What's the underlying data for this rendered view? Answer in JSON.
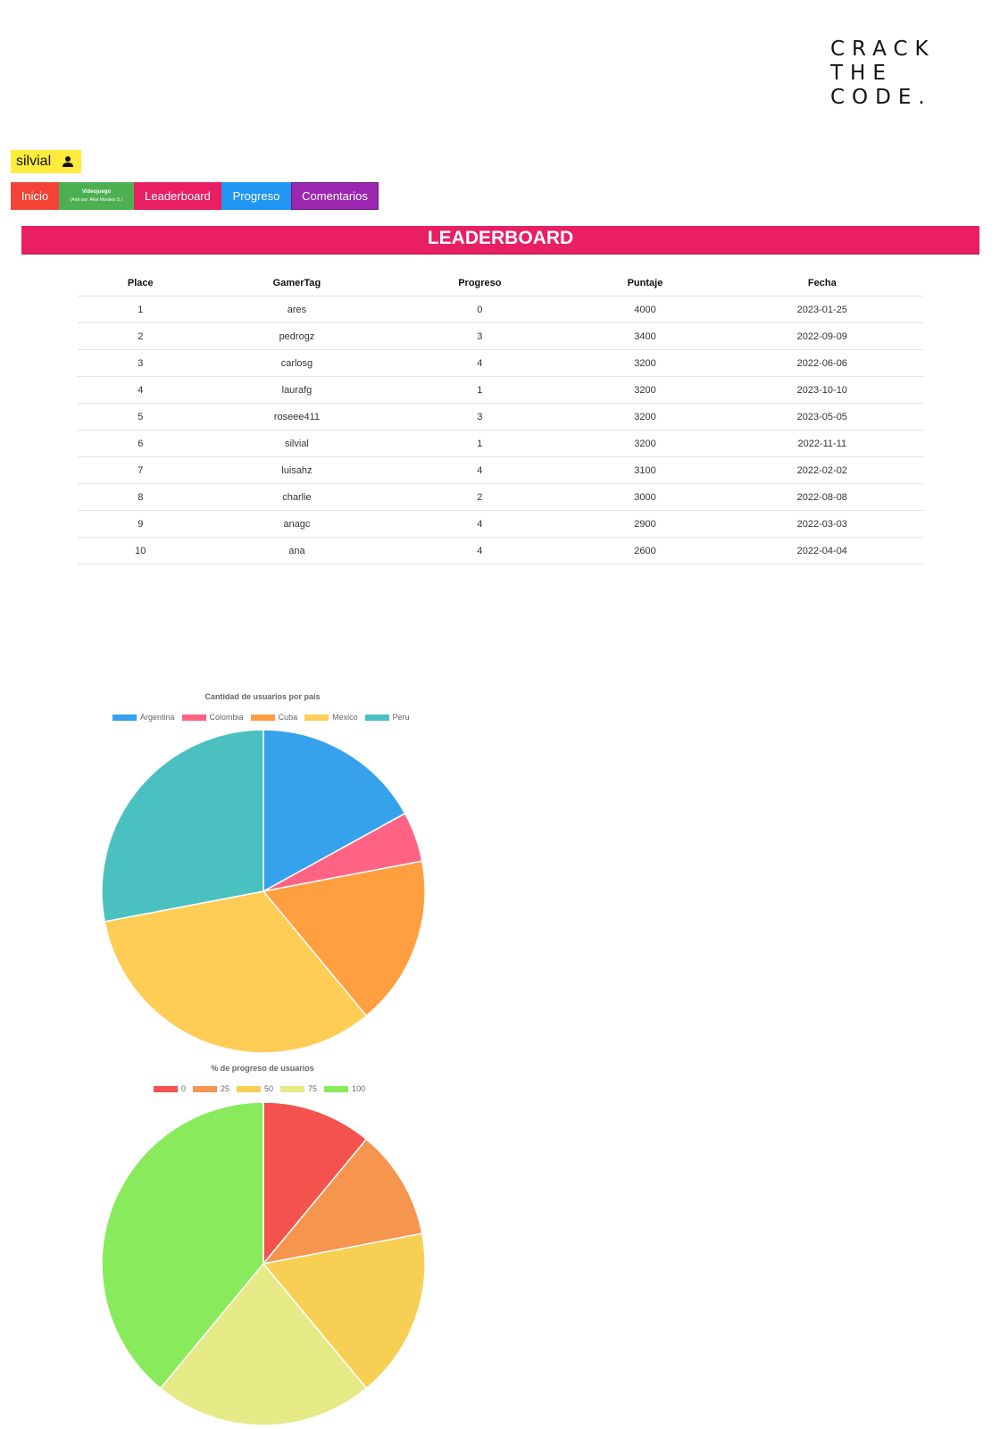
{
  "logo": {
    "lines": [
      "CRACK",
      "THE",
      "CODE."
    ]
  },
  "user": {
    "name": "silvial",
    "icon": "person-icon"
  },
  "nav": {
    "inicio": "Inicio",
    "videojuego_title": "Videojuego",
    "videojuego_sub": "(Arte por: Alex Morales S.)",
    "leaderboard": "Leaderboard",
    "progreso": "Progreso",
    "comentarios": "Comentarios",
    "colors": {
      "inicio": "#f44336",
      "videojuego": "#4caf50",
      "leaderboard": "#e91e63",
      "progreso": "#2196f3",
      "comentarios": "#9c27b0"
    }
  },
  "banner": {
    "title": "LEADERBOARD",
    "color": "#e91e63"
  },
  "table": {
    "headers": [
      "Place",
      "GamerTag",
      "Progreso",
      "Puntaje",
      "Fecha"
    ],
    "rows": [
      [
        "1",
        "ares",
        "0",
        "4000",
        "2023-01-25"
      ],
      [
        "2",
        "pedrogz",
        "3",
        "3400",
        "2022-09-09"
      ],
      [
        "3",
        "carlosg",
        "4",
        "3200",
        "2022-06-06"
      ],
      [
        "4",
        "laurafg",
        "1",
        "3200",
        "2023-10-10"
      ],
      [
        "5",
        "roseee411",
        "3",
        "3200",
        "2023-05-05"
      ],
      [
        "6",
        "silvial",
        "1",
        "3200",
        "2022-11-11"
      ],
      [
        "7",
        "luisahz",
        "4",
        "3100",
        "2022-02-02"
      ],
      [
        "8",
        "charlie",
        "2",
        "3000",
        "2022-08-08"
      ],
      [
        "9",
        "anagc",
        "4",
        "2900",
        "2022-03-03"
      ],
      [
        "10",
        "ana",
        "4",
        "2600",
        "2022-04-04"
      ]
    ]
  },
  "chart_data": [
    {
      "type": "pie",
      "title": "Cantidad de usuarios por país",
      "categories": [
        "Argentina",
        "Colombia",
        "Cuba",
        "México",
        "Peru"
      ],
      "values": [
        17,
        5,
        17,
        33,
        28
      ],
      "colors": [
        "#36a2eb",
        "#ff6384",
        "#ff9f40",
        "#ffcd56",
        "#4bc0c0"
      ],
      "legend": "top"
    },
    {
      "type": "pie",
      "title": "% de progreso de usuarios",
      "categories": [
        "0",
        "25",
        "50",
        "75",
        "100"
      ],
      "values": [
        11,
        11,
        17,
        22,
        39
      ],
      "colors": [
        "#f4524d",
        "#f6954d",
        "#f7cf52",
        "#e5ea86",
        "#89ea5c"
      ],
      "legend": "top"
    }
  ]
}
